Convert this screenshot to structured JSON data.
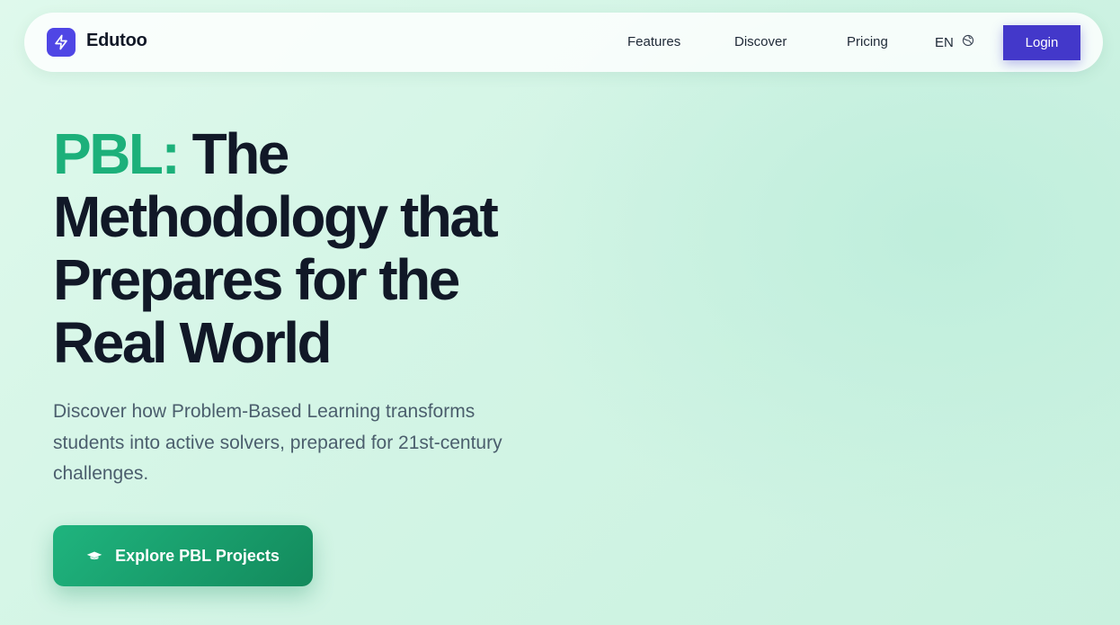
{
  "nav": {
    "brand": "Edutoo",
    "links": [
      {
        "label": "Features"
      },
      {
        "label": "Discover"
      },
      {
        "label": "Pricing"
      }
    ],
    "language": "EN",
    "login_label": "Login"
  },
  "hero": {
    "title_accent": "PBL:",
    "title_rest": " The Methodology that Prepares for the Real World",
    "subtitle": "Discover how Problem-Based Learning transforms students into active solvers, prepared for 21st-century challenges.",
    "cta_label": "Explore PBL Projects"
  },
  "colors": {
    "brand_purple": "#4f46e5",
    "login_purple": "#4338ca",
    "accent_green": "#1cb07a",
    "cta_green": "#1fb47e"
  },
  "icons": {
    "logo": "lightning-bolt-icon",
    "language": "globe-icon",
    "cta": "graduation-cap-icon"
  }
}
